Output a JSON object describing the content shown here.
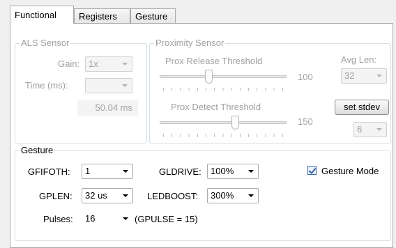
{
  "tabs": [
    {
      "label": "Functional",
      "active": true
    },
    {
      "label": "Registers",
      "active": false
    },
    {
      "label": "Gesture",
      "active": false
    }
  ],
  "als": {
    "legend": "ALS Sensor",
    "gain_label": "Gain:",
    "gain_value": "1x",
    "time_label": "Time (ms):",
    "time_value": "",
    "time_readout": "50.04 ms"
  },
  "proximity": {
    "legend": "Proximity Sensor",
    "release_label": "Prox Release Threshold",
    "release_value": "100",
    "detect_label": "Prox Detect Threshold",
    "detect_value": "150",
    "avg_len_label": "Avg Len:",
    "avg_len_value": "32",
    "set_stdev_label": "set stdev",
    "stdev_value": "6"
  },
  "gesture": {
    "legend": "Gesture",
    "gfifoth_label": "GFIFOTH:",
    "gfifoth_value": "1",
    "gldrive_label": "GLDRIVE:",
    "gldrive_value": "100%",
    "gesture_mode_label": "Gesture Mode",
    "gesture_mode_checked": true,
    "gplen_label": "GPLEN:",
    "gplen_value": "32 us",
    "ledboost_label": "LEDBOOST:",
    "ledboost_value": "300%",
    "pulses_label": "Pulses:",
    "pulses_value": "16",
    "gpulse_text": "(GPULSE = 15)"
  }
}
